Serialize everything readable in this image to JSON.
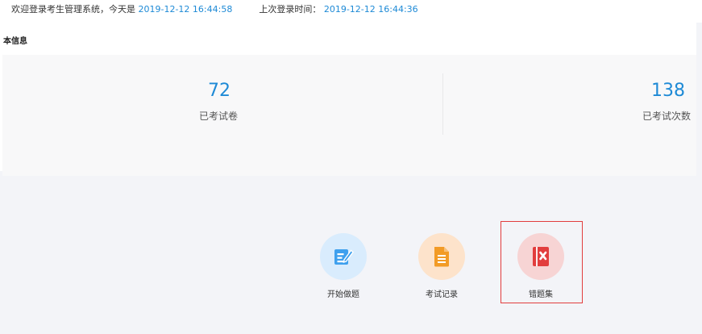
{
  "topbar": {
    "welcome_prefix": "欢迎登录考生管理系统，今天是",
    "today": "2019-12-12 16:44:58",
    "last_login_label": "上次登录时间：",
    "last_login": "2019-12-12 16:44:36"
  },
  "panel": {
    "title": "本信息"
  },
  "stats": [
    {
      "value": "72",
      "label": "已考试卷"
    },
    {
      "value": "138",
      "label": "已考试次数"
    }
  ],
  "actions": [
    {
      "label": "开始做题",
      "icon": "edit-icon",
      "color": "#3ea0ee",
      "bg": "#d9ecfd"
    },
    {
      "label": "考试记录",
      "icon": "document-icon",
      "color": "#f29b26",
      "bg": "#fde3cb"
    },
    {
      "label": "错题集",
      "icon": "wrong-book-icon",
      "color": "#e23d3d",
      "bg": "#f7d4d4"
    }
  ],
  "selected_action": "错题集"
}
